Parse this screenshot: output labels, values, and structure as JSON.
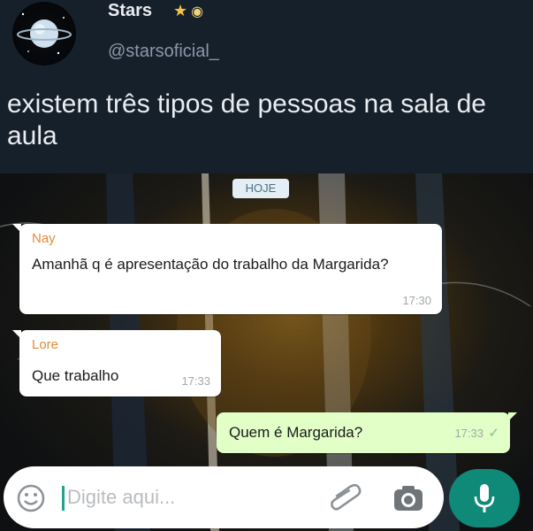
{
  "tweet": {
    "display_name": "Stars",
    "name_emojis": [
      "star-emoji",
      "eye-emoji"
    ],
    "handle": "@starsoficial_",
    "text": "existem três tipos de pessoas na sala de aula"
  },
  "chat": {
    "date_label": "HOJE",
    "messages": [
      {
        "sender": "Nay",
        "text": "Amanhã q é apresentação do trabalho da Margarida?",
        "time": "17:30",
        "direction": "incoming"
      },
      {
        "sender": "Lore",
        "text": "Que trabalho",
        "time": "17:33",
        "direction": "incoming"
      },
      {
        "sender": "",
        "text": "Quem é Margarida?",
        "time": "17:33",
        "direction": "outgoing",
        "status": "✓"
      }
    ]
  },
  "input": {
    "placeholder": "Digite aqui...",
    "icons": [
      "emoji-icon",
      "paperclip-icon",
      "camera-icon",
      "microphone-icon"
    ]
  },
  "colors": {
    "tweet_bg": "#16202b",
    "sender_name": "#e38a3a",
    "outgoing_bubble": "#e1ffc7",
    "mic_button": "#0f8a78"
  }
}
